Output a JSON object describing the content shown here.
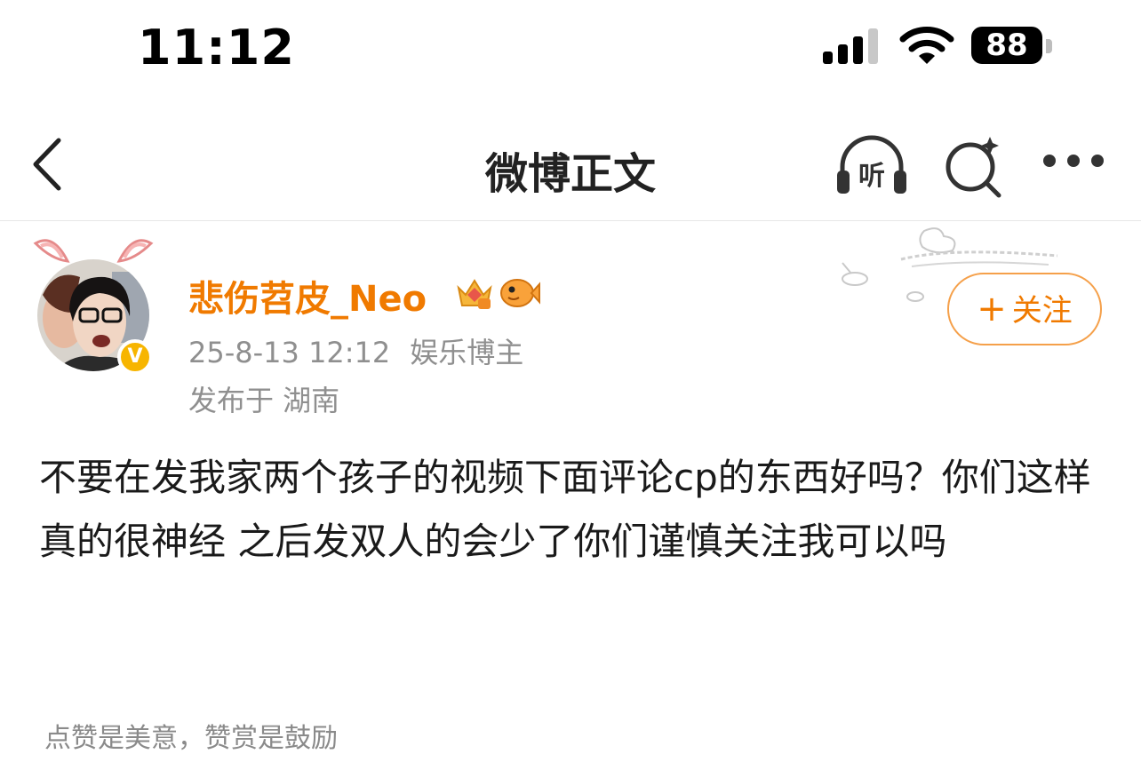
{
  "status_bar": {
    "time": "11:12",
    "battery": "88"
  },
  "nav": {
    "title": "微博正文",
    "listen_label": "听"
  },
  "colors": {
    "accent": "#f07a00",
    "meta": "#8f8f8f",
    "verified": "#f7b500"
  },
  "author": {
    "name": "悲伤苕皮_Neo",
    "verified_mark": "V",
    "date": "25-8-13 12:12",
    "tag": "娱乐博主",
    "location": "发布于 湖南"
  },
  "follow_button": {
    "plus": "+",
    "label": "关注"
  },
  "post": {
    "text": "不要在发我家两个孩子的视频下面评论cp的东西好吗？你们这样真的很神经 之后发双人的会少了你们谨慎关注我可以吗"
  },
  "reward_hint": "点赞是美意，赞赏是鼓励",
  "icons": [
    "chevron-left-icon",
    "listen-icon",
    "search-icon",
    "more-icon",
    "crown-icon",
    "fish-icon"
  ]
}
